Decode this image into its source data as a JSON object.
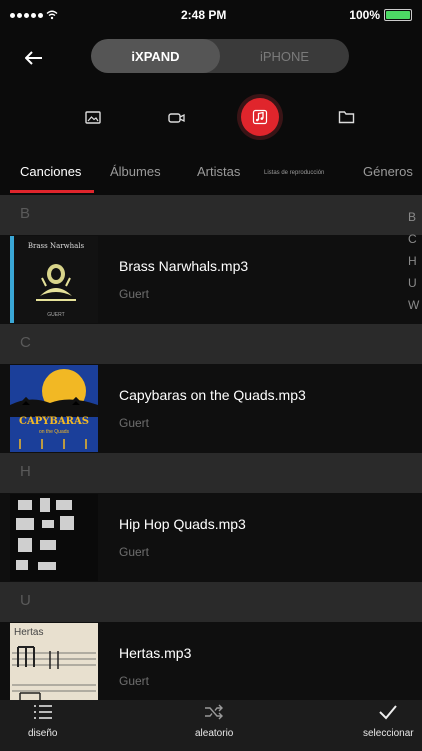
{
  "status_bar": {
    "time": "2:48 PM",
    "battery": "100%"
  },
  "header": {
    "segments": [
      {
        "label": "iXPAND",
        "active": true
      },
      {
        "label": "iPHONE",
        "active": false
      }
    ]
  },
  "icon_bar": {
    "items": [
      {
        "icon": "photo-icon",
        "active": false
      },
      {
        "icon": "video-camera-icon",
        "active": false
      },
      {
        "icon": "music-note-icon",
        "active": true
      },
      {
        "icon": "folder-icon",
        "active": false
      }
    ],
    "accent": "#e0252c"
  },
  "tabs": [
    {
      "label": "Canciones",
      "active": true
    },
    {
      "label": "Álbumes",
      "active": false
    },
    {
      "label": "Artistas",
      "active": false
    },
    {
      "label": "Listas de reproducción",
      "active": false
    },
    {
      "label": "Géneros",
      "active": false
    }
  ],
  "sections": [
    {
      "letter": "B",
      "songs": [
        {
          "title": "Brass Narwhals.mp3",
          "artist": "Guert",
          "art_text": "Brass Narwhals",
          "art_sub": "GUERT"
        }
      ]
    },
    {
      "letter": "C",
      "songs": [
        {
          "title": "Capybaras on the Quads.mp3",
          "artist": "Guert",
          "art_text": "CAPYBARAS",
          "art_sub": "on the Quads"
        }
      ]
    },
    {
      "letter": "H",
      "songs": [
        {
          "title": "Hip Hop Quads.mp3",
          "artist": "Guert"
        }
      ]
    },
    {
      "letter": "U",
      "songs": [
        {
          "title": "Hertas.mp3",
          "artist": "Guert",
          "art_text": "Hertas"
        }
      ]
    }
  ],
  "index_letters": [
    "B",
    "C",
    "H",
    "U",
    "W"
  ],
  "bottom_bar": {
    "layout_label": "diseño",
    "shuffle_label": "aleatorio",
    "select_label": "seleccionar"
  }
}
